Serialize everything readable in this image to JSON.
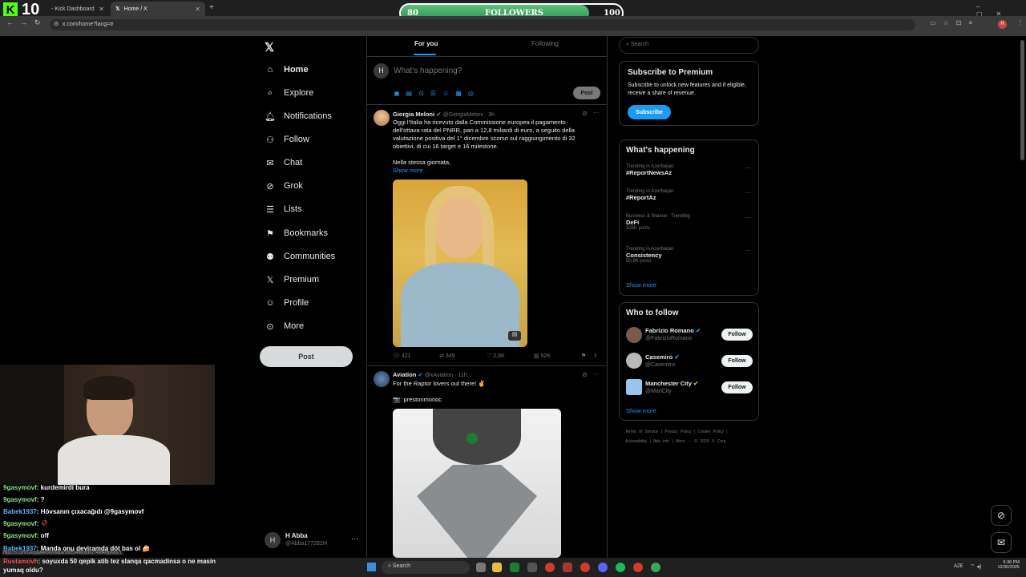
{
  "browser": {
    "tabs": [
      {
        "label": "- Kick Dashboard"
      },
      {
        "label": "Home / X"
      }
    ],
    "url": "x.com/home?lang=tr"
  },
  "overlay": {
    "kick_count": "10",
    "followers_bar": {
      "start": "80",
      "label": "FOLLOWERS",
      "goal": "100",
      "progress_percent": 85
    }
  },
  "x": {
    "nav": [
      "Home",
      "Explore",
      "Notifications",
      "Follow",
      "Chat",
      "Grok",
      "Lists",
      "Bookmarks",
      "Communities",
      "Premium",
      "Profile",
      "More"
    ],
    "post_button": "Post",
    "account": {
      "name": "H Abba",
      "handle": "@Abba177262H"
    },
    "header_tabs": [
      "For you",
      "Following"
    ],
    "compose": {
      "placeholder": "What's happening?",
      "post": "Post",
      "avatar_letter": "H"
    },
    "tweets": [
      {
        "author": "Giorgia Meloni",
        "handle": "@GiorgiaMeloni",
        "time": "· 3h",
        "text": "Oggi l'Italia ha ricevuto dalla Commissione europea il pagamento dell'ottava rata del PNRR, pari a 12,8 miliardi di euro, a seguito della valutazione positiva del 1° dicembre scorso sul raggiungimento di 32 obiettivi, di cui 16 target e 16 milestone.",
        "text2": "Nella stessa giornata,",
        "show_more": "Show more",
        "replies": "421",
        "reposts": "349",
        "likes": "2,6K",
        "views": "52K"
      },
      {
        "author": "Aviation",
        "handle": "@xAviation",
        "time": "· 11h",
        "text": "For the Raptor lovers out there! ✌",
        "text2": "📷: prestonmonoc"
      }
    ],
    "search_placeholder": "Search",
    "premium": {
      "title": "Subscribe to Premium",
      "body": "Subscribe to unlock new features and if eligible, receive a share of revenue.",
      "button": "Subscribe"
    },
    "happening": {
      "title": "What's happening",
      "trends": [
        {
          "context": "Trending in Azerbaijan",
          "name": "#ReportNewsAz",
          "meta": ""
        },
        {
          "context": "Trending in Azerbaijan",
          "name": "#ReportAz",
          "meta": ""
        },
        {
          "context": "Business & finance · Trending",
          "name": "DeFi",
          "meta": "105K posts"
        },
        {
          "context": "Trending in Azerbaijan",
          "name": "Consistency",
          "meta": "50,9K posts"
        }
      ],
      "show_more": "Show more"
    },
    "who_to_follow": {
      "title": "Who to follow",
      "accounts": [
        {
          "name": "Fabrizio Romano",
          "handle": "@FabrizioRomano"
        },
        {
          "name": "Casemiro",
          "handle": "@Casemiro"
        },
        {
          "name": "Manchester City",
          "handle": "@ManCity"
        }
      ],
      "follow_label": "Follow",
      "show_more": "Show more"
    },
    "footer": {
      "line1": [
        "Terms of Service",
        "|",
        "Privacy Policy",
        "|",
        "Cookie Policy",
        "|"
      ],
      "line2": [
        "Accessibility",
        "|",
        "Ads info",
        "|",
        "More ···",
        "© 2025 X Corp."
      ]
    }
  },
  "chat": [
    {
      "user": "9gasymovf",
      "msg": ": kurdemirdi bura"
    },
    {
      "user": "9gasymovf",
      "msg": ": ?"
    },
    {
      "user": "Babek1937",
      "msg": ": Hövsanın çıxacağıdı @9gasymovf"
    },
    {
      "user": "9gasymovf",
      "msg": ": 🥀"
    },
    {
      "user": "9gasymovf",
      "msg": ": off"
    },
    {
      "user": "Babek1937",
      "msg": ": Manda onu deyiramda döt bas ol 🍰"
    },
    {
      "user": "Rustamovh",
      "msg": ": soyuxda 50 qepik atib tez slanqa qacmadinsa o ne masin yumaq oldu?"
    }
  ],
  "status_url": "https://x.com/GiorgiaMeloni/status/2005949609302749840/photo/1",
  "taskbar": {
    "search": "Search",
    "lang": "AZE",
    "time": "5:36 PM",
    "date": "12/30/2025"
  },
  "colors": {
    "accent": "#1d9bf0",
    "followers_green": "#4caf68",
    "kick_green": "#53fc18"
  }
}
